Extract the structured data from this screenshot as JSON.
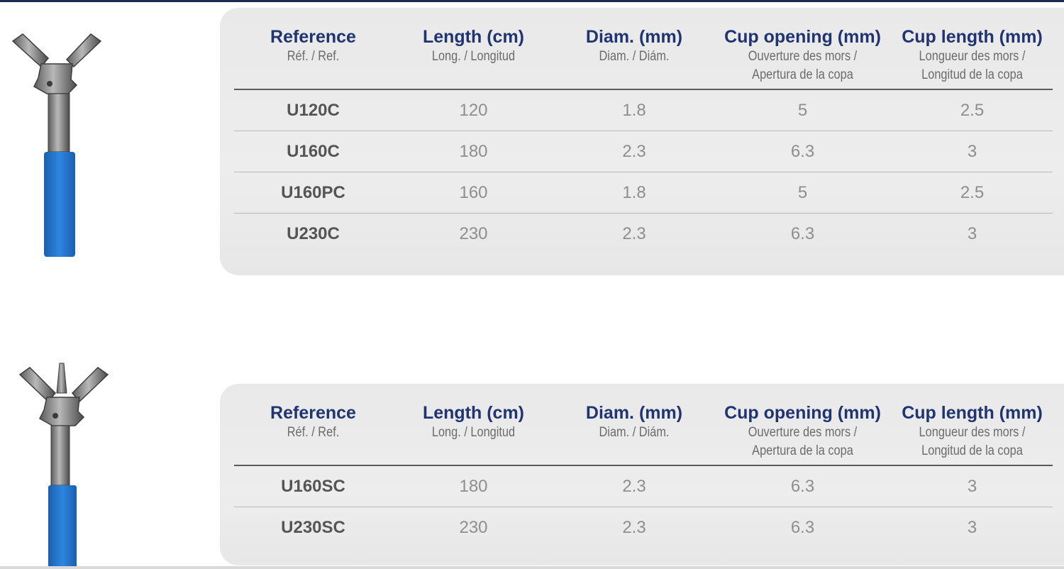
{
  "colors": {
    "heading": "#1f3470",
    "subheading": "#6b6b6b",
    "reference": "#555555",
    "value": "#8e8e8e",
    "panel": "#ebebeb",
    "sheath": "#1f6fc4"
  },
  "headers": [
    {
      "main": "Reference",
      "sub1": "Réf. / Ref.",
      "sub2": ""
    },
    {
      "main": "Length (cm)",
      "sub1": "Long. / Longitud",
      "sub2": ""
    },
    {
      "main": "Diam. (mm)",
      "sub1": "Diam. / Diám.",
      "sub2": ""
    },
    {
      "main": "Cup opening (mm)",
      "sub1": "Ouverture des mors /",
      "sub2": "Apertura de la copa"
    },
    {
      "main": "Cup length (mm)",
      "sub1": "Longueur des mors /",
      "sub2": "Longitud de la copa"
    }
  ],
  "tables": [
    {
      "product_image": "biopsy-forceps-oval-cup",
      "rows": [
        [
          "U120C",
          "120",
          "1.8",
          "5",
          "2.5"
        ],
        [
          "U160C",
          "180",
          "2.3",
          "6.3",
          "3"
        ],
        [
          "U160PC",
          "160",
          "1.8",
          "5",
          "2.5"
        ],
        [
          "U230C",
          "230",
          "2.3",
          "6.3",
          "3"
        ]
      ]
    },
    {
      "product_image": "biopsy-forceps-with-spike",
      "rows": [
        [
          "U160SC",
          "180",
          "2.3",
          "6.3",
          "3"
        ],
        [
          "U230SC",
          "230",
          "2.3",
          "6.3",
          "3"
        ]
      ]
    }
  ]
}
